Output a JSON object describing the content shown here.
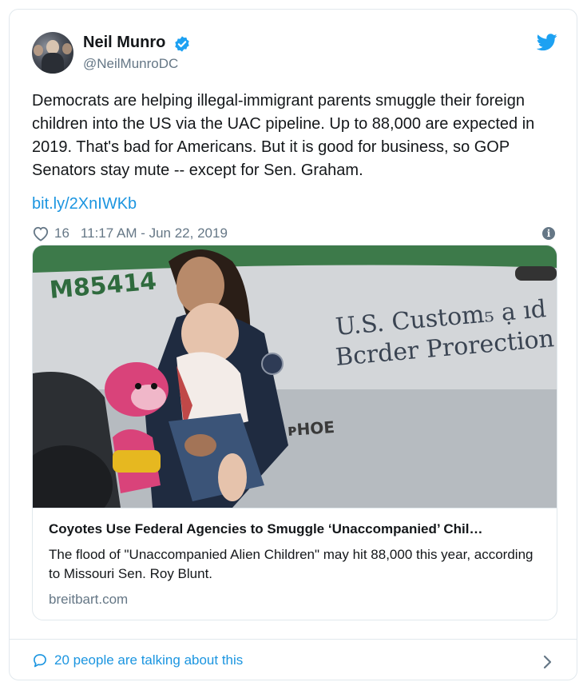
{
  "author": {
    "name": "Neil Munro",
    "handle": "@NeilMunroDC"
  },
  "tweet": {
    "text": "Democrats are helping illegal-immigrant parents smuggle their foreign children into the US via the UAC pipeline. Up to 88,000 are expected in 2019. That's bad for Americans. But it is good for business, so GOP Senators stay mute -- except for Sen. Graham.",
    "link": "bit.ly/2XnIWKb",
    "likes": "16",
    "timestamp": "11:17 AM - Jun 22, 2019"
  },
  "card": {
    "image_text": {
      "vehicle_number": "M85414",
      "agency_line1": "U.S. Custom₅ ạ ıd",
      "agency_line2": "Bcrder Prorection",
      "plate_fragment": "ᴘHOE"
    },
    "title": "Coyotes Use Federal Agencies to Smuggle ‘Unaccompanied’ Chil…",
    "description": "The flood of \"Unaccompanied Alien Children\" may hit 88,000 this year, according to Missouri Sen. Roy Blunt.",
    "domain": "breitbart.com"
  },
  "footer": {
    "talking": "20 people are talking about this"
  },
  "colors": {
    "accent": "#1b95e0",
    "muted": "#657786",
    "border": "#e1e8ed",
    "verified": "#1da1f2"
  }
}
